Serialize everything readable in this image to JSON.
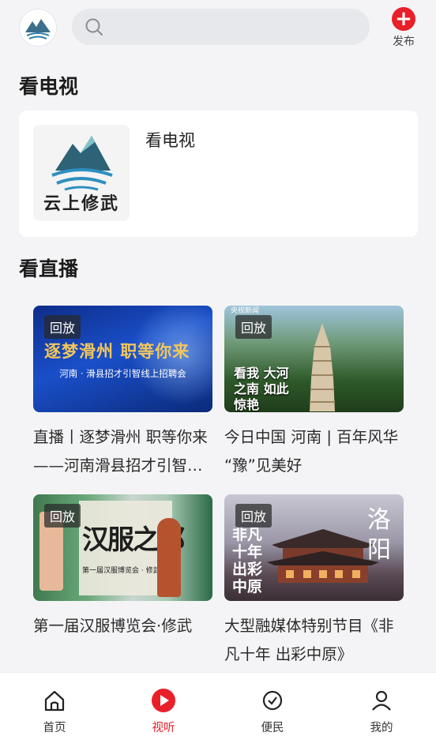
{
  "header": {
    "search_placeholder": "",
    "publish_label": "发布",
    "brand_color": "#e8202a"
  },
  "tv_section": {
    "title": "看电视",
    "channel": {
      "name": "看电视",
      "logo_text": "云上修武"
    }
  },
  "live_section": {
    "title": "看直播",
    "items": [
      {
        "badge": "回放",
        "title": "直播丨逐梦滑州 职等你来——河南滑县招才引智线上招聘会",
        "thumb_headline": "逐梦滑州 职等你来",
        "thumb_sub": "河南 · 滑县招才引智线上招聘会"
      },
      {
        "badge": "回放",
        "title": "今日中国 河南 | 百年风华 “豫”见美好",
        "thumb_tag": "央视新闻",
        "thumb_headline": "看我 大河之南 如此惊艳"
      },
      {
        "badge": "回放",
        "title": "第一届汉服博览会·修武",
        "thumb_headline": "汉服之都",
        "thumb_sub": "第一届汉服博览会 · 修武"
      },
      {
        "badge": "回放",
        "title": "大型融媒体特别节目《非凡十年 出彩中原》",
        "thumb_headline": "洛阳",
        "thumb_calli": "非凡十年 出彩中原"
      }
    ]
  },
  "bottom_nav": {
    "items": [
      {
        "label": "首页",
        "icon": "home-icon",
        "active": false
      },
      {
        "label": "视听",
        "icon": "play-icon",
        "active": true
      },
      {
        "label": "便民",
        "icon": "service-icon",
        "active": false
      },
      {
        "label": "我的",
        "icon": "user-icon",
        "active": false
      }
    ]
  }
}
